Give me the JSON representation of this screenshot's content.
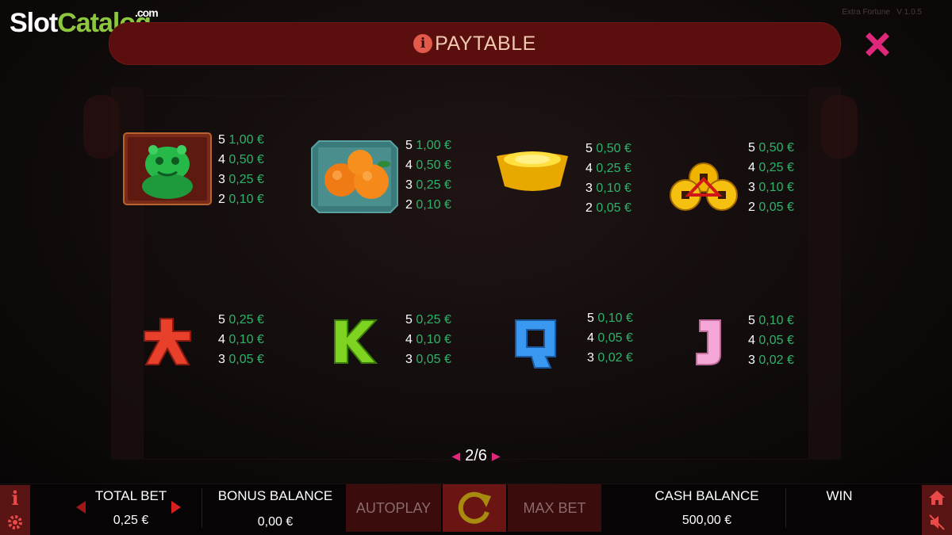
{
  "watermark": {
    "part1": "Slot",
    "part2": "Catalog",
    "part3": ".com"
  },
  "game_info": {
    "name": "Extra Fortune",
    "version": "V 1.0.5"
  },
  "header": {
    "title": "PAYTABLE",
    "info_glyph": "i",
    "close_glyph": "✕"
  },
  "symbols": [
    {
      "icon": "jade-lion-icon",
      "pays": [
        [
          "5",
          "1,00 €"
        ],
        [
          "4",
          "0,50 €"
        ],
        [
          "3",
          "0,25 €"
        ],
        [
          "2",
          "0,10 €"
        ]
      ]
    },
    {
      "icon": "oranges-icon",
      "pays": [
        [
          "5",
          "1,00 €"
        ],
        [
          "4",
          "0,50 €"
        ],
        [
          "3",
          "0,25 €"
        ],
        [
          "2",
          "0,10 €"
        ]
      ]
    },
    {
      "icon": "gold-ingot-icon",
      "pays": [
        [
          "5",
          "0,50 €"
        ],
        [
          "4",
          "0,25 €"
        ],
        [
          "3",
          "0,10 €"
        ],
        [
          "2",
          "0,05 €"
        ]
      ]
    },
    {
      "icon": "coins-icon",
      "pays": [
        [
          "5",
          "0,50 €"
        ],
        [
          "4",
          "0,25 €"
        ],
        [
          "3",
          "0,10 €"
        ],
        [
          "2",
          "0,05 €"
        ]
      ]
    },
    {
      "icon": "a-symbol-icon",
      "pays": [
        [
          "5",
          "0,25 €"
        ],
        [
          "4",
          "0,10 €"
        ],
        [
          "3",
          "0,05 €"
        ]
      ]
    },
    {
      "icon": "k-symbol-icon",
      "pays": [
        [
          "5",
          "0,25 €"
        ],
        [
          "4",
          "0,10 €"
        ],
        [
          "3",
          "0,05 €"
        ]
      ]
    },
    {
      "icon": "q-symbol-icon",
      "pays": [
        [
          "5",
          "0,10 €"
        ],
        [
          "4",
          "0,05 €"
        ],
        [
          "3",
          "0,02 €"
        ]
      ]
    },
    {
      "icon": "j-symbol-icon",
      "pays": [
        [
          "5",
          "0,10 €"
        ],
        [
          "4",
          "0,05 €"
        ],
        [
          "3",
          "0,02 €"
        ]
      ]
    }
  ],
  "pager": {
    "text": "2/6",
    "prev": "◀",
    "next": "▶"
  },
  "bottom_bar": {
    "total_bet_label": "TOTAL BET",
    "total_bet_value": "0,25 €",
    "bonus_balance_label": "BONUS BALANCE",
    "bonus_balance_value": "0,00 €",
    "autoplay_label": "AUTOPLAY",
    "max_bet_label": "MAX BET",
    "cash_balance_label": "CASH BALANCE",
    "cash_balance_value": "500,00 €",
    "win_label": "WIN",
    "info_glyph": "i"
  },
  "colors": {
    "accent": "#e0287a",
    "pay_value": "#2db36a",
    "title_bar": "#5a0e0e"
  }
}
